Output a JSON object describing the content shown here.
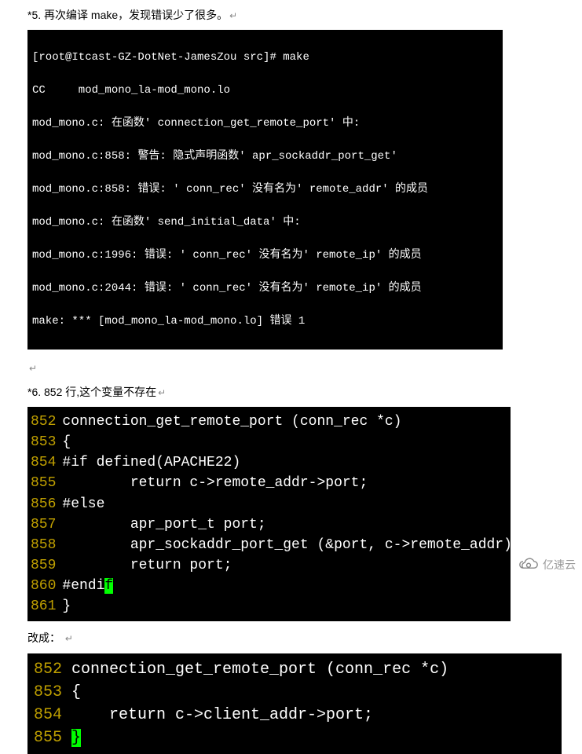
{
  "para1": "*5. 再次编译 make，发现错误少了很多。",
  "return_symbol": "↵",
  "terminal1": {
    "l1": "[root@Itcast-GZ-DotNet-JamesZou src]# make",
    "l2": "CC     mod_mono_la-mod_mono.lo",
    "l3": "mod_mono.c: 在函数' connection_get_remote_port' 中:",
    "l4": "mod_mono.c:858: 警告: 隐式声明函数' apr_sockaddr_port_get'",
    "l5": "mod_mono.c:858: 错误: ' conn_rec' 没有名为' remote_addr' 的成员",
    "l6": "mod_mono.c: 在函数' send_initial_data' 中:",
    "l7": "mod_mono.c:1996: 错误: ' conn_rec' 没有名为' remote_ip' 的成员",
    "l8": "mod_mono.c:2044: 错误: ' conn_rec' 没有名为' remote_ip' 的成员",
    "l9": "make: *** [mod_mono_la-mod_mono.lo] 错误 1"
  },
  "para2": "*6. 852 行,这个变量不存在",
  "terminal2": [
    {
      "n": "852",
      "c": "connection_get_remote_port (conn_rec *c)"
    },
    {
      "n": "853",
      "c": "{"
    },
    {
      "n": "854",
      "c": "#if defined(APACHE22)"
    },
    {
      "n": "855",
      "c": "        return c->remote_addr->port;"
    },
    {
      "n": "856",
      "c": "#else"
    },
    {
      "n": "857",
      "c": "        apr_port_t port;"
    },
    {
      "n": "858",
      "c": "        apr_sockaddr_port_get (&port, c->remote_addr);"
    },
    {
      "n": "859",
      "c": "        return port;"
    },
    {
      "n": "860",
      "c": "#endi",
      "cursor_char": "f"
    },
    {
      "n": "861",
      "c": "}"
    }
  ],
  "para3": "改成：",
  "terminal3": [
    {
      "n": "852",
      "c": "connection_get_remote_port (conn_rec *c)"
    },
    {
      "n": "853",
      "c": "{"
    },
    {
      "n": "854",
      "c": "    return c->client_addr->port;"
    },
    {
      "n": "855",
      "c": "",
      "cursor_char": "}"
    }
  ],
  "watermark_text": "亿速云"
}
